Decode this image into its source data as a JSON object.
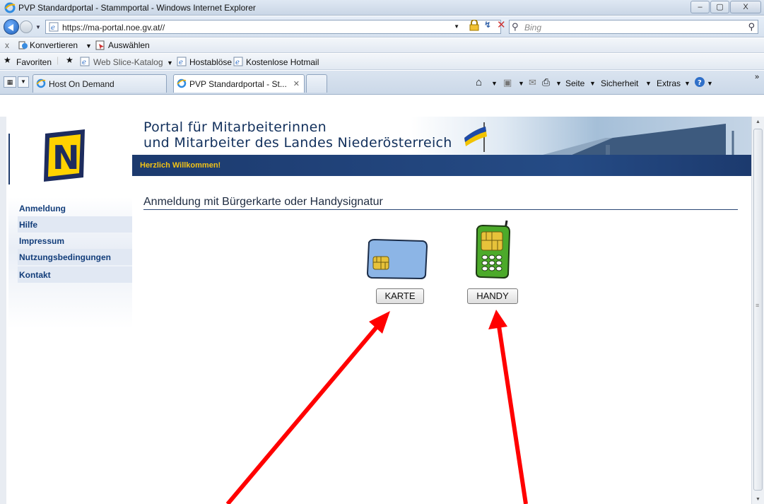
{
  "window": {
    "title": "PVP Standardportal - Stammportal - Windows Internet Explorer",
    "controls": [
      "–",
      "▢",
      "X"
    ]
  },
  "address_bar": {
    "url": "https://ma-portal.noe.gv.at//",
    "search_placeholder": "Bing"
  },
  "command_bar": {
    "close": "x",
    "convert": "Konvertieren",
    "select": "Auswählen"
  },
  "favorites_bar": {
    "favorites": "Favoriten",
    "items": [
      "Web Slice-Katalog",
      "Hostablöse",
      "Kostenlose Hotmail"
    ]
  },
  "tabs": [
    {
      "label": "Host On Demand"
    },
    {
      "label": "PVP Standardportal - St..."
    }
  ],
  "toolbar_right": {
    "page": "Seite",
    "security": "Sicherheit",
    "extras": "Extras"
  },
  "banner": {
    "title_line1": "Portal für Mitarbeiterinnen",
    "title_line2": "und Mitarbeiter des Landes Niederösterreich",
    "welcome": "Herzlich Willkommen!"
  },
  "sidebar": {
    "logo_letter": "N",
    "items": [
      {
        "label": "Anmeldung"
      },
      {
        "label": "Hilfe"
      },
      {
        "label": "Impressum"
      },
      {
        "label": "Nutzungsbedingungen"
      },
      {
        "label": "Kontakt"
      }
    ]
  },
  "main": {
    "heading": "Anmeldung mit Bürgerkarte oder Handysignatur",
    "card_button": "KARTE",
    "phone_button": "HANDY"
  },
  "colors": {
    "brand_navy": "#1c3a6e",
    "welcome_yellow": "#f3c316",
    "arrow_red": "#ff0000",
    "link_blue": "#123d7a"
  }
}
